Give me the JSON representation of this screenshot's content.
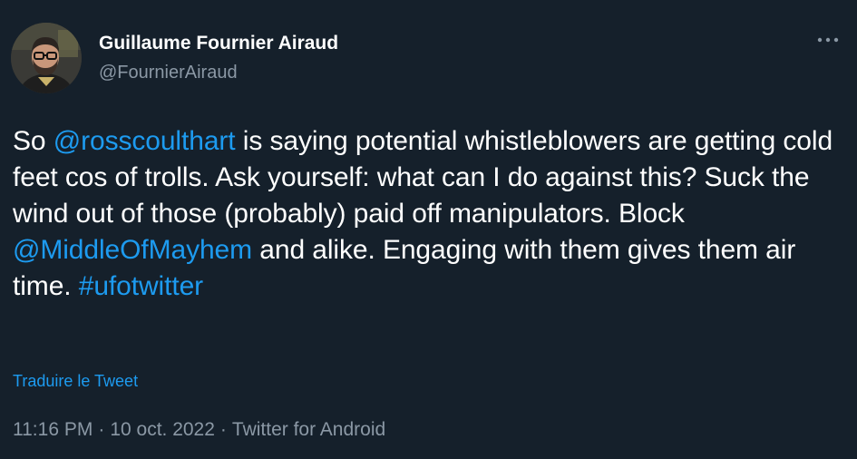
{
  "author": {
    "display_name": "Guillaume Fournier Airaud",
    "handle": "@FournierAiraud"
  },
  "tweet": {
    "text_1": "So ",
    "mention_1": "@rosscoulthart",
    "text_2": " is saying potential whistleblowers are getting cold feet cos of trolls. Ask yourself: what can I do against this? Suck the wind out of those (probably) paid off manipulators. Block ",
    "mention_2": "@MiddleOfMayhem",
    "text_3": " and alike. Engaging with them gives them air time. ",
    "hashtag": "#ufotwitter"
  },
  "translate_label": "Traduire le Tweet",
  "meta": {
    "time": "11:16 PM",
    "separator": "·",
    "date": "10 oct. 2022",
    "source": "Twitter for Android"
  },
  "colors": {
    "background": "#15202b",
    "text": "#ffffff",
    "secondary": "#8b98a5",
    "link": "#1d9bf0"
  },
  "icons": {
    "more": "more-horizontal-icon",
    "avatar": "profile-photo"
  }
}
